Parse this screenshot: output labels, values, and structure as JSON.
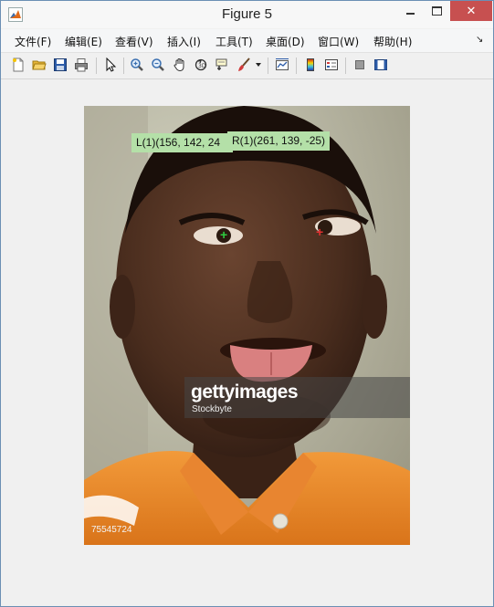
{
  "window": {
    "title": "Figure 5"
  },
  "menu": {
    "items": [
      "文件(F)",
      "编辑(E)",
      "查看(V)",
      "插入(I)",
      "工具(T)",
      "桌面(D)",
      "窗口(W)",
      "帮助(H)"
    ]
  },
  "toolbar": {
    "icons": [
      "new-figure-icon",
      "open-file-icon",
      "save-icon",
      "print-icon",
      "edit-plot-arrow-icon",
      "zoom-in-icon",
      "zoom-out-icon",
      "pan-hand-icon",
      "rotate-3d-icon",
      "data-cursor-icon",
      "brush-icon",
      "link-plot-icon",
      "colorbar-icon",
      "legend-icon",
      "hide-plot-tools-icon",
      "show-plot-tools-icon"
    ]
  },
  "figure": {
    "datatip_left": "L(1)(156, 142, 24",
    "datatip_right": "R(1)(261, 139, -25)",
    "watermark_brand": "gettyimages",
    "watermark_sub": "Stockbyte",
    "image_id": "75545724"
  },
  "colors": {
    "datatip_bg": "#b4e0a8",
    "marker_left": "#2ecc40",
    "marker_right": "#e53030",
    "shirt": "#e88a2a"
  }
}
